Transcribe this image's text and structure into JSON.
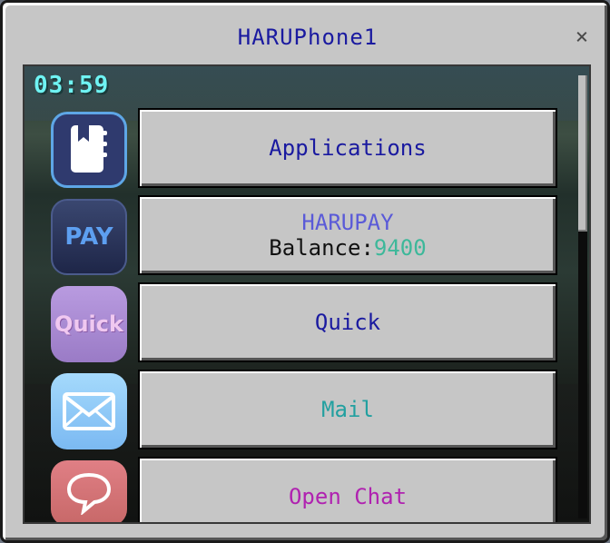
{
  "window": {
    "title": "HARUPhone1",
    "close_glyph": "×"
  },
  "status": {
    "time": "03:59"
  },
  "apps": [
    {
      "icon": "book-icon",
      "label": "Applications",
      "color": "#1a1aa0"
    },
    {
      "icon": "pay-icon",
      "icon_text": "PAY",
      "title": "HARUPAY",
      "balance_label": "Balance:",
      "balance_value": "9400"
    },
    {
      "icon": "quick-icon",
      "icon_text": "Quick",
      "label": "Quick",
      "color": "#1a1aa0"
    },
    {
      "icon": "mail-icon",
      "label": "Mail",
      "color": "#22a0a0"
    },
    {
      "icon": "chat-bubble-icon",
      "label": "Open Chat",
      "color": "#b022b0"
    }
  ],
  "colors": {
    "clock": "#6ff3f3",
    "balance_value": "#3db89a",
    "pay_title": "#5a5ad8"
  }
}
